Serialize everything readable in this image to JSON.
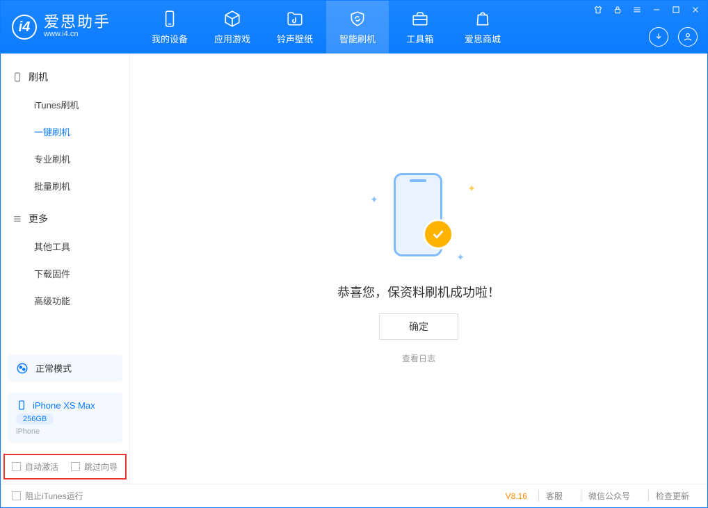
{
  "app": {
    "name": "爱思助手",
    "domain": "www.i4.cn"
  },
  "nav": {
    "my_device": "我的设备",
    "apps_games": "应用游戏",
    "ring_wall": "铃声壁纸",
    "smart_flash": "智能刷机",
    "toolbox": "工具箱",
    "store": "爱思商城"
  },
  "sidebar": {
    "cat_flash": "刷机",
    "items": {
      "itunes": "iTunes刷机",
      "oneclick": "一键刷机",
      "pro": "专业刷机",
      "batch": "批量刷机"
    },
    "cat_more": "更多",
    "more": {
      "other_tools": "其他工具",
      "download_fw": "下载固件",
      "advanced": "高级功能"
    },
    "mode": "正常模式",
    "device": {
      "name": "iPhone XS Max",
      "capacity": "256GB",
      "type": "iPhone"
    },
    "checks": {
      "auto_activate": "自动激活",
      "skip_guide": "跳过向导"
    }
  },
  "main": {
    "success": "恭喜您，保资料刷机成功啦！",
    "ok": "确定",
    "view_log": "查看日志"
  },
  "footer": {
    "block_itunes": "阻止iTunes运行",
    "version": "V8.16",
    "support": "客服",
    "wechat": "微信公众号",
    "check_update": "检查更新"
  }
}
